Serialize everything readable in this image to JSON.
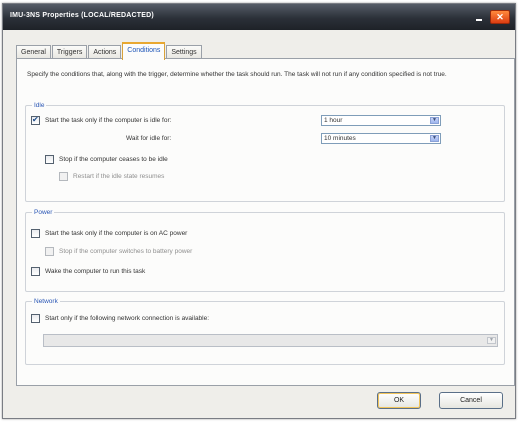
{
  "window": {
    "title": "IMU-3NS Properties (LOCAL/REDACTED)",
    "close_glyph": "✕"
  },
  "tabs": [
    {
      "label": "General",
      "active": false
    },
    {
      "label": "Triggers",
      "active": false
    },
    {
      "label": "Actions",
      "active": false
    },
    {
      "label": "Conditions",
      "active": true
    },
    {
      "label": "Settings",
      "active": false
    }
  ],
  "description": "Specify the conditions that, along with the trigger, determine whether the task should run. The task will not run if any condition specified is not true.",
  "idle": {
    "label": "Idle",
    "start_if_idle": {
      "label": "Start the task only if the computer is idle for:",
      "checked": true
    },
    "idle_for_value": "1 hour",
    "wait_label": "Wait for idle for:",
    "wait_value": "10 minutes",
    "stop_if_not_idle": {
      "label": "Stop if the computer ceases to be idle",
      "checked": false
    },
    "restart_if_idle": {
      "label": "Restart if the idle state resumes",
      "checked": false
    }
  },
  "power": {
    "label": "Power",
    "ac_power": {
      "label": "Start the task only if the computer is on AC power",
      "checked": false
    },
    "battery_stop": {
      "label": "Stop if the computer switches to battery power",
      "checked": false
    },
    "wake": {
      "label": "Wake the computer to run this task",
      "checked": false
    }
  },
  "network": {
    "label": "Network",
    "start_if_network": {
      "label": "Start only if the following network connection is available:",
      "checked": false
    },
    "connection_value": ""
  },
  "buttons": {
    "ok": "OK",
    "cancel": "Cancel"
  },
  "colors": {
    "accent": "#2a56b5",
    "title_bar": "#2b3038",
    "active_tab_border": "#e9a830"
  },
  "icons": {
    "dropdown": "chevron-down-icon",
    "check": "checkmark-icon"
  }
}
